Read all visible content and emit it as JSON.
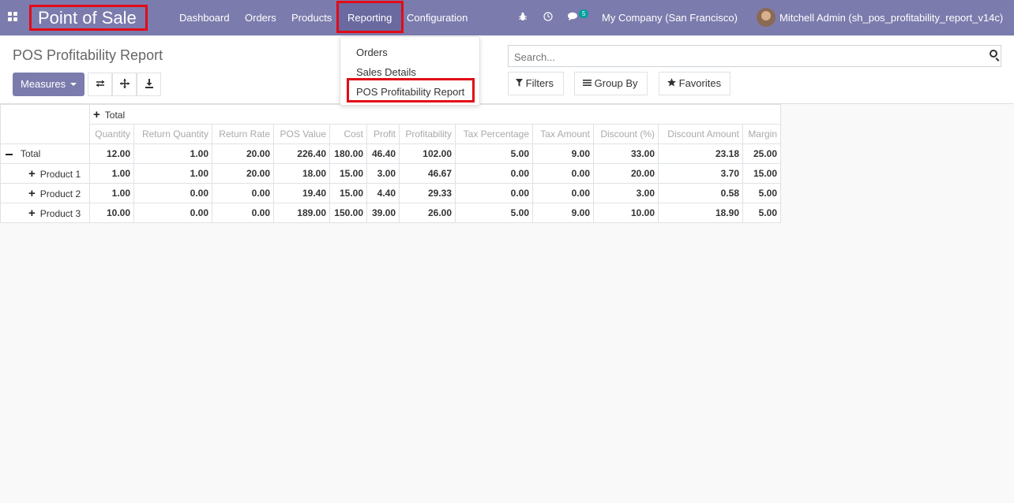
{
  "app": {
    "name": "Point of Sale"
  },
  "menu": [
    "Dashboard",
    "Orders",
    "Products",
    "Reporting",
    "Configuration"
  ],
  "systray": {
    "messages_count": "5",
    "company": "My Company (San Francisco)",
    "user": "Mitchell Admin (sh_pos_profitability_report_v14c)"
  },
  "page": {
    "title": "POS Profitability Report"
  },
  "toolbar": {
    "measures_label": "Measures"
  },
  "search": {
    "placeholder": "Search..."
  },
  "filters": {
    "filters_label": "Filters",
    "groupby_label": "Group By",
    "favorites_label": "Favorites"
  },
  "reporting_menu": [
    "Orders",
    "Sales Details",
    "POS Profitability Report"
  ],
  "pivot": {
    "col_group": "Total",
    "measures": [
      "Quantity",
      "Return Quantity",
      "Return Rate",
      "POS Value",
      "Cost",
      "Profit",
      "Profitability",
      "Tax Percentage",
      "Tax Amount",
      "Discount (%)",
      "Discount Amount",
      "Margin"
    ],
    "rows": [
      {
        "label": "Total",
        "values": [
          "12.00",
          "1.00",
          "20.00",
          "226.40",
          "180.00",
          "46.40",
          "102.00",
          "5.00",
          "9.00",
          "33.00",
          "23.18",
          "25.00"
        ]
      },
      {
        "label": "Product 1",
        "values": [
          "1.00",
          "1.00",
          "20.00",
          "18.00",
          "15.00",
          "3.00",
          "46.67",
          "0.00",
          "0.00",
          "20.00",
          "3.70",
          "15.00"
        ]
      },
      {
        "label": "Product 2",
        "values": [
          "1.00",
          "0.00",
          "0.00",
          "19.40",
          "15.00",
          "4.40",
          "29.33",
          "0.00",
          "0.00",
          "3.00",
          "0.58",
          "5.00"
        ]
      },
      {
        "label": "Product 3",
        "values": [
          "10.00",
          "0.00",
          "0.00",
          "189.00",
          "150.00",
          "39.00",
          "26.00",
          "5.00",
          "9.00",
          "10.00",
          "18.90",
          "5.00"
        ]
      }
    ]
  }
}
